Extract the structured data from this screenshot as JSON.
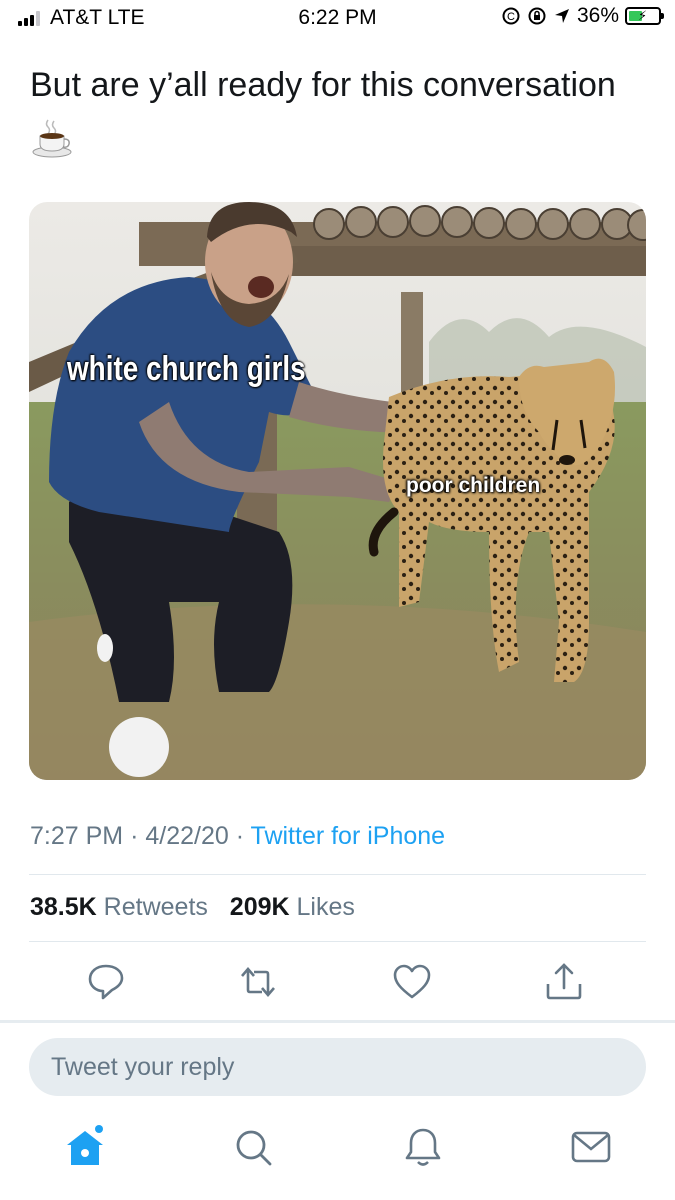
{
  "status_bar": {
    "carrier": "AT&T LTE",
    "time": "6:22 PM",
    "battery": "36%"
  },
  "tweet": {
    "text": "But are y’all ready for this conversation",
    "emoji": "hot-beverage",
    "media": {
      "caption_left": "white church girls",
      "caption_right": "poor children"
    },
    "time": "7:27 PM",
    "date": "4/22/20",
    "source": "Twitter for iPhone",
    "retweets_count": "38.5K",
    "retweets_label": "Retweets",
    "likes_count": "209K",
    "likes_label": "Likes"
  },
  "reply": {
    "placeholder": "Tweet your reply"
  },
  "colors": {
    "accent": "#1da1f2",
    "secondary_text": "#657786",
    "divider": "#e1e8ed",
    "battery": "#34c759"
  }
}
